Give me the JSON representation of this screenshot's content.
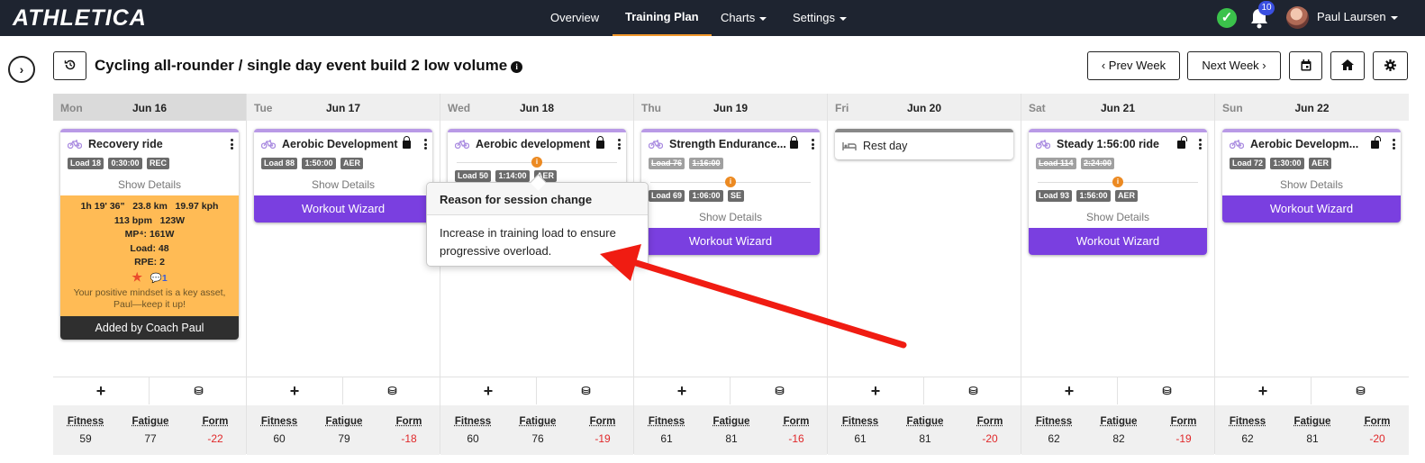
{
  "app": {
    "logo": "ATHLETICA"
  },
  "nav": {
    "items": [
      {
        "label": "Overview"
      },
      {
        "label": "Training Plan",
        "active": true
      },
      {
        "label": "Charts",
        "dropdown": true
      },
      {
        "label": "Settings",
        "dropdown": true
      }
    ],
    "notifications": "10",
    "user": "Paul Laursen"
  },
  "toolbar": {
    "title": "Cycling all-rounder / single day event build 2 low volume",
    "prev_week": "Prev Week",
    "next_week": "Next Week"
  },
  "days": [
    {
      "name": "Mon",
      "date": "Jun 16",
      "card": {
        "title": "Recovery ride",
        "tags": [
          "Load 18",
          "0:30:00",
          "REC"
        ],
        "show": "Show Details",
        "summary": {
          "line1": "1h 19' 36\"   23.8 km   19.97 kph",
          "line2": "113 bpm   123W",
          "mp": "MP⁴: 161W",
          "load": "Load: 48",
          "rpe": "RPE: 2",
          "comments": "1",
          "motiv": "Your positive mindset is a key asset, Paul—keep it up!"
        },
        "coach": "Added by Coach Paul"
      },
      "fitness": "59",
      "fatigue": "77",
      "form": "-22"
    },
    {
      "name": "Tue",
      "date": "Jun 17",
      "card": {
        "title": "Aerobic Development",
        "tags": [
          "Load 88",
          "1:50:00",
          "AER"
        ],
        "show": "Show Details",
        "wizard": "Workout Wizard"
      },
      "fitness": "60",
      "fatigue": "79",
      "form": "-18"
    },
    {
      "name": "Wed",
      "date": "Jun 18",
      "card": {
        "title": "Aerobic development",
        "tags": [
          "Load 50",
          "1:14:00",
          "AER"
        ]
      },
      "fitness": "60",
      "fatigue": "76",
      "form": "-19"
    },
    {
      "name": "Thu",
      "date": "Jun 19",
      "card": {
        "title": "Strength Endurance...",
        "old_tags": [
          "Load 76",
          "1:16:00"
        ],
        "tags": [
          "Load 69",
          "1:06:00",
          "SE"
        ],
        "show": "Show Details",
        "wizard": "Workout Wizard"
      },
      "fitness": "61",
      "fatigue": "81",
      "form": "-16"
    },
    {
      "name": "Fri",
      "date": "Jun 20",
      "card": {
        "title": "Rest day"
      },
      "fitness": "61",
      "fatigue": "81",
      "form": "-20"
    },
    {
      "name": "Sat",
      "date": "Jun 21",
      "card": {
        "title": "Steady 1:56:00 ride",
        "old_tags": [
          "Load 114",
          "2:24:00"
        ],
        "tags": [
          "Load 93",
          "1:56:00",
          "AER"
        ],
        "show": "Show Details",
        "wizard": "Workout Wizard"
      },
      "fitness": "62",
      "fatigue": "82",
      "form": "-19"
    },
    {
      "name": "Sun",
      "date": "Jun 22",
      "card": {
        "title": "Aerobic Developm...",
        "tags": [
          "Load 72",
          "1:30:00",
          "AER"
        ],
        "show": "Show Details",
        "wizard": "Workout Wizard"
      },
      "fitness": "62",
      "fatigue": "81",
      "form": "-20"
    }
  ],
  "metric_labels": {
    "fitness": "Fitness",
    "fatigue": "Fatigue",
    "form": "Form"
  },
  "tooltip": {
    "title": "Reason for session change",
    "body": "Increase in training load to ensure progressive overload."
  },
  "colors": {
    "accent": "#7a3fe0",
    "orange": "#ffbb55",
    "arrow": "#f01c12",
    "negative": "#e0282a"
  }
}
